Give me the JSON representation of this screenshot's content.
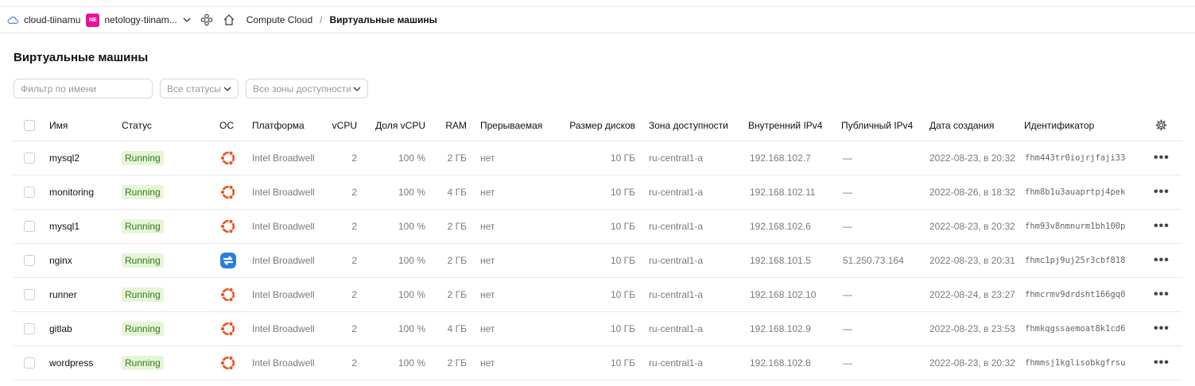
{
  "topbar": {
    "cloud": "cloud-tiinamu",
    "folder_badge": "NE",
    "folder": "netology-tiinam...",
    "service": "Compute Cloud",
    "separator": "/",
    "current": "Виртуальные машины"
  },
  "page_title": "Виртуальные машины",
  "filters": {
    "name_placeholder": "Фильтр по имени",
    "status": "Все статусы",
    "zone": "Все зоны доступности"
  },
  "columns": {
    "name": "Имя",
    "status": "Статус",
    "os": "ОС",
    "platform": "Платформа",
    "vcpu": "vCPU",
    "vcpu_share": "Доля vCPU",
    "ram": "RAM",
    "preemptible": "Прерываемая",
    "disk": "Размер дисков",
    "zone": "Зона доступности",
    "ipv4_int": "Внутренний IPv4",
    "ipv4_pub": "Публичный IPv4",
    "created": "Дата создания",
    "id": "Идентификатор"
  },
  "accent": {
    "ubuntu": "#e95420",
    "other_os": "#2a7fdb",
    "running_bg": "#e6f5d8",
    "running_fg": "#2f7d16"
  },
  "rows": [
    {
      "name": "mysql2",
      "status": "Running",
      "os_icon": "ubuntu-icon",
      "platform": "Intel Broadwell",
      "vcpu": "2",
      "share": "100 %",
      "ram": "2 ГБ",
      "pre": "нет",
      "disk": "10 ГБ",
      "zone": "ru-central1-a",
      "ip_int": "192.168.102.7",
      "ip_pub": "—",
      "created": "2022-08-23, в 20:32",
      "id": "fhm443tr0iojrjfaji33"
    },
    {
      "name": "monitoring",
      "status": "Running",
      "os_icon": "ubuntu-icon",
      "platform": "Intel Broadwell",
      "vcpu": "2",
      "share": "100 %",
      "ram": "4 ГБ",
      "pre": "нет",
      "disk": "10 ГБ",
      "zone": "ru-central1-a",
      "ip_int": "192.168.102.11",
      "ip_pub": "—",
      "created": "2022-08-26, в 18:32",
      "id": "fhm8b1u3auaprtpj4pek"
    },
    {
      "name": "mysql1",
      "status": "Running",
      "os_icon": "ubuntu-icon",
      "platform": "Intel Broadwell",
      "vcpu": "2",
      "share": "100 %",
      "ram": "2 ГБ",
      "pre": "нет",
      "disk": "10 ГБ",
      "zone": "ru-central1-a",
      "ip_int": "192.168.102.6",
      "ip_pub": "—",
      "created": "2022-08-23, в 20:32",
      "id": "fhm93v8nmnurm1bh100p"
    },
    {
      "name": "nginx",
      "status": "Running",
      "os_icon": "nat-instance-icon",
      "platform": "Intel Broadwell",
      "vcpu": "2",
      "share": "100 %",
      "ram": "2 ГБ",
      "pre": "нет",
      "disk": "10 ГБ",
      "zone": "ru-central1-a",
      "ip_int": "192.168.101.5",
      "ip_pub": "51.250.73.164",
      "created": "2022-08-23, в 20:31",
      "id": "fhmc1pj9uj25r3cbf818"
    },
    {
      "name": "runner",
      "status": "Running",
      "os_icon": "ubuntu-icon",
      "platform": "Intel Broadwell",
      "vcpu": "2",
      "share": "100 %",
      "ram": "2 ГБ",
      "pre": "нет",
      "disk": "10 ГБ",
      "zone": "ru-central1-a",
      "ip_int": "192.168.102.10",
      "ip_pub": "—",
      "created": "2022-08-24, в 23:27",
      "id": "fhmcrmv9drdsht166gq0"
    },
    {
      "name": "gitlab",
      "status": "Running",
      "os_icon": "ubuntu-icon",
      "platform": "Intel Broadwell",
      "vcpu": "2",
      "share": "100 %",
      "ram": "4 ГБ",
      "pre": "нет",
      "disk": "10 ГБ",
      "zone": "ru-central1-a",
      "ip_int": "192.168.102.9",
      "ip_pub": "—",
      "created": "2022-08-23, в 23:53",
      "id": "fhmkqgssaemoat8k1cd6"
    },
    {
      "name": "wordpress",
      "status": "Running",
      "os_icon": "ubuntu-icon",
      "platform": "Intel Broadwell",
      "vcpu": "2",
      "share": "100 %",
      "ram": "2 ГБ",
      "pre": "нет",
      "disk": "10 ГБ",
      "zone": "ru-central1-a",
      "ip_int": "192.168.102.8",
      "ip_pub": "—",
      "created": "2022-08-23, в 20:32",
      "id": "fhmmsj1kglisobkgfrsu"
    }
  ]
}
